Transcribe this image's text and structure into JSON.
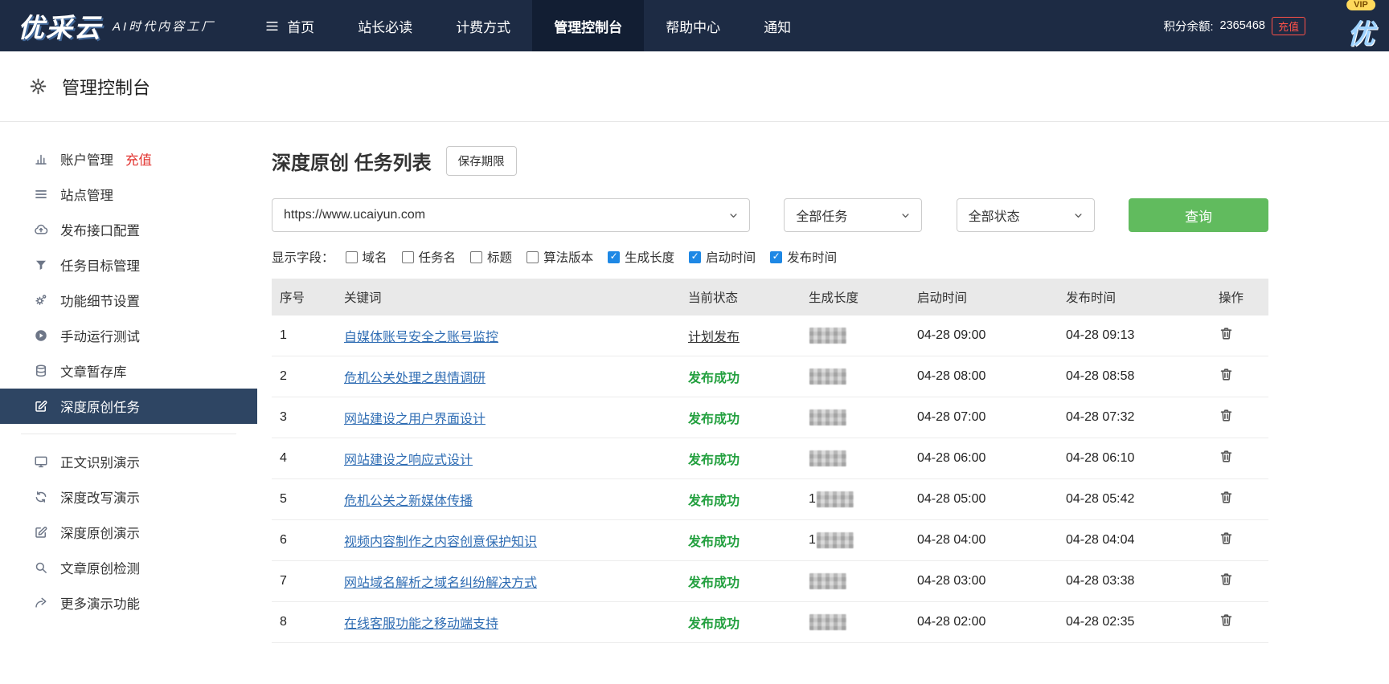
{
  "colors": {
    "navbar_bg": "#1d2b44",
    "active_nav_bg": "#121e33",
    "sidebar_active_bg": "#2e4563",
    "accent_green": "#61bb5e",
    "success_green": "#23a03f",
    "link_blue": "#2e6cb3",
    "checkbox_blue": "#1e88e5",
    "recharge_red": "#ff5148",
    "vip_yellow": "#ffd95c"
  },
  "navbar": {
    "logo_text": "优采云",
    "logo_slogan": "AI时代内容工厂",
    "items": [
      {
        "label": "首页",
        "icon": "menu"
      },
      {
        "label": "站长必读"
      },
      {
        "label": "计费方式"
      },
      {
        "label": "管理控制台",
        "active": true
      },
      {
        "label": "帮助中心"
      },
      {
        "label": "通知"
      }
    ],
    "points_label": "积分余额:",
    "points_value": "2365468",
    "recharge_label": "充值",
    "vip_label": "VIP",
    "vip_logo": "优"
  },
  "page_header": {
    "title": "管理控制台"
  },
  "sidebar": {
    "items": [
      {
        "label": "账户管理",
        "suffix": "充值",
        "icon": "bar-chart"
      },
      {
        "label": "站点管理",
        "icon": "list"
      },
      {
        "label": "发布接口配置",
        "icon": "cloud-upload"
      },
      {
        "label": "任务目标管理",
        "icon": "filter"
      },
      {
        "label": "功能细节设置",
        "icon": "gears"
      },
      {
        "label": "手动运行测试",
        "icon": "play"
      },
      {
        "label": "文章暂存库",
        "icon": "database"
      },
      {
        "label": "深度原创任务",
        "icon": "edit",
        "active": true
      }
    ],
    "demo_items": [
      {
        "label": "正文识别演示",
        "icon": "monitor"
      },
      {
        "label": "深度改写演示",
        "icon": "refresh"
      },
      {
        "label": "深度原创演示",
        "icon": "edit"
      },
      {
        "label": "文章原创检测",
        "icon": "search"
      },
      {
        "label": "更多演示功能",
        "icon": "arrow-right"
      }
    ]
  },
  "main": {
    "title": "深度原创 任务列表",
    "save_period_button": "保存期限",
    "filters": {
      "domain_select": "https://www.ucaiyun.com",
      "task_select": "全部任务",
      "status_select": "全部状态",
      "query_button": "查询"
    },
    "display_fields": {
      "label": "显示字段：",
      "options": [
        {
          "label": "域名",
          "checked": false
        },
        {
          "label": "任务名",
          "checked": false
        },
        {
          "label": "标题",
          "checked": false
        },
        {
          "label": "算法版本",
          "checked": false
        },
        {
          "label": "生成长度",
          "checked": true
        },
        {
          "label": "启动时间",
          "checked": true
        },
        {
          "label": "发布时间",
          "checked": true
        }
      ]
    },
    "table": {
      "headers": [
        "序号",
        "关键词",
        "当前状态",
        "生成长度",
        "启动时间",
        "发布时间",
        "操作"
      ],
      "rows": [
        {
          "index": "1",
          "keyword": "自媒体账号安全之账号监控",
          "status": "计划发布",
          "status_type": "planned",
          "length_visible": "",
          "length_masked": true,
          "start_time": "04-28 09:00",
          "publish_time": "04-28 09:13"
        },
        {
          "index": "2",
          "keyword": "危机公关处理之舆情调研",
          "status": "发布成功",
          "status_type": "success",
          "length_visible": "",
          "length_masked": true,
          "start_time": "04-28 08:00",
          "publish_time": "04-28 08:58"
        },
        {
          "index": "3",
          "keyword": "网站建设之用户界面设计",
          "status": "发布成功",
          "status_type": "success",
          "length_visible": "",
          "length_masked": true,
          "start_time": "04-28 07:00",
          "publish_time": "04-28 07:32"
        },
        {
          "index": "4",
          "keyword": "网站建设之响应式设计",
          "status": "发布成功",
          "status_type": "success",
          "length_visible": "",
          "length_masked": true,
          "start_time": "04-28 06:00",
          "publish_time": "04-28 06:10"
        },
        {
          "index": "5",
          "keyword": "危机公关之新媒体传播",
          "status": "发布成功",
          "status_type": "success",
          "length_visible": "1",
          "length_masked": true,
          "start_time": "04-28 05:00",
          "publish_time": "04-28 05:42"
        },
        {
          "index": "6",
          "keyword": "视频内容制作之内容创意保护知识",
          "status": "发布成功",
          "status_type": "success",
          "length_visible": "1",
          "length_masked": true,
          "start_time": "04-28 04:00",
          "publish_time": "04-28 04:04"
        },
        {
          "index": "7",
          "keyword": "网站域名解析之域名纠纷解决方式",
          "status": "发布成功",
          "status_type": "success",
          "length_visible": "",
          "length_masked": true,
          "start_time": "04-28 03:00",
          "publish_time": "04-28 03:38"
        },
        {
          "index": "8",
          "keyword": "在线客服功能之移动端支持",
          "status": "发布成功",
          "status_type": "success",
          "length_visible": "",
          "length_masked": true,
          "start_time": "04-28 02:00",
          "publish_time": "04-28 02:35"
        }
      ]
    }
  }
}
